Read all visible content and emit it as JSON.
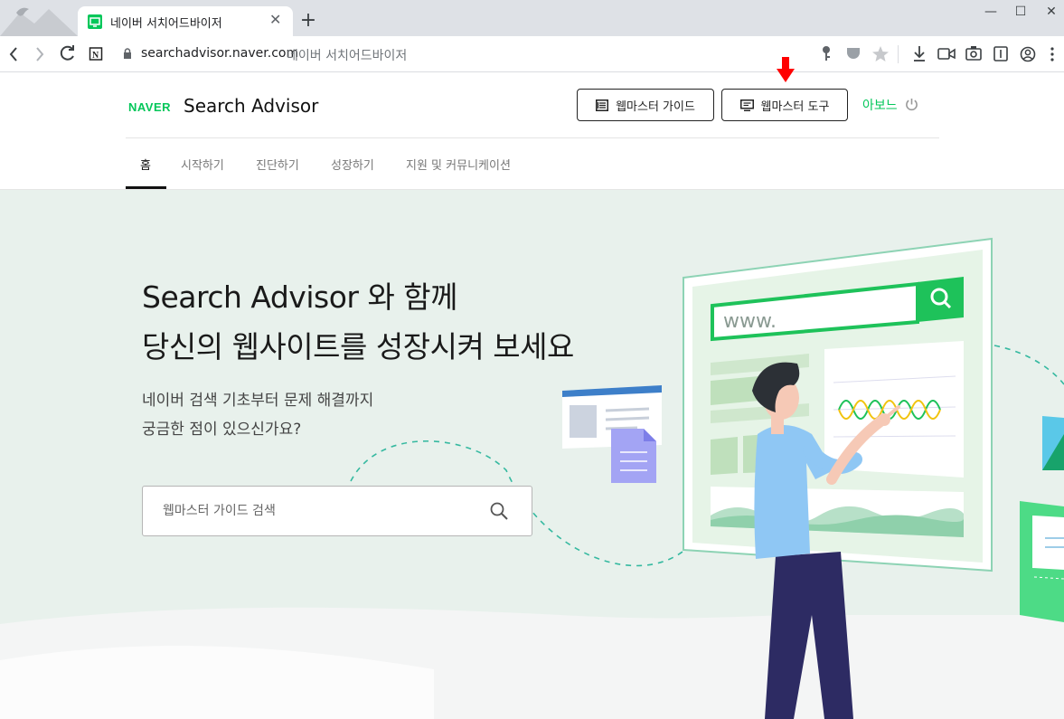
{
  "browser": {
    "tab_title": "네이버 서치어드바이저",
    "new_tab": "+",
    "url_host": "searchadvisor.naver.com",
    "url_page_title": "네이버 서치어드바이저",
    "tab_close": "✕",
    "window_controls": {
      "minimize": "—",
      "maximize": "☐",
      "close": "✕"
    }
  },
  "header": {
    "logo": "NAVER",
    "brand": "Search Advisor",
    "guide_button": "웹마스터 가이드",
    "tools_button": "웹마스터 도구",
    "about_link": "아보느",
    "nav": [
      "홈",
      "시작하기",
      "진단하기",
      "성장하기",
      "지원 및 커뮤니케이션"
    ]
  },
  "hero": {
    "heading_line1": "Search Advisor 와 함께",
    "heading_line2": "당신의 웹사이트를 성장시켜 보세요",
    "sub_line1": "네이버 검색 기초부터 문제 해결까지",
    "sub_line2": "궁금한 점이 있으신가요?",
    "search_placeholder": "웹마스터 가이드 검색",
    "illustration_url_text": "www."
  },
  "colors": {
    "naver_green": "#03c75a",
    "hero_bg": "#e8f1ec",
    "annotation_arrow": "#ff0000"
  },
  "icons": [
    "back-icon",
    "forward-icon",
    "reload-icon",
    "notion-icon",
    "lock-icon",
    "key-icon",
    "shield-icon",
    "star-icon",
    "download-icon",
    "video-icon",
    "camera-icon",
    "reader-icon",
    "profile-icon",
    "menu-icon",
    "book-icon",
    "monitor-icon",
    "power-icon",
    "search-icon"
  ]
}
